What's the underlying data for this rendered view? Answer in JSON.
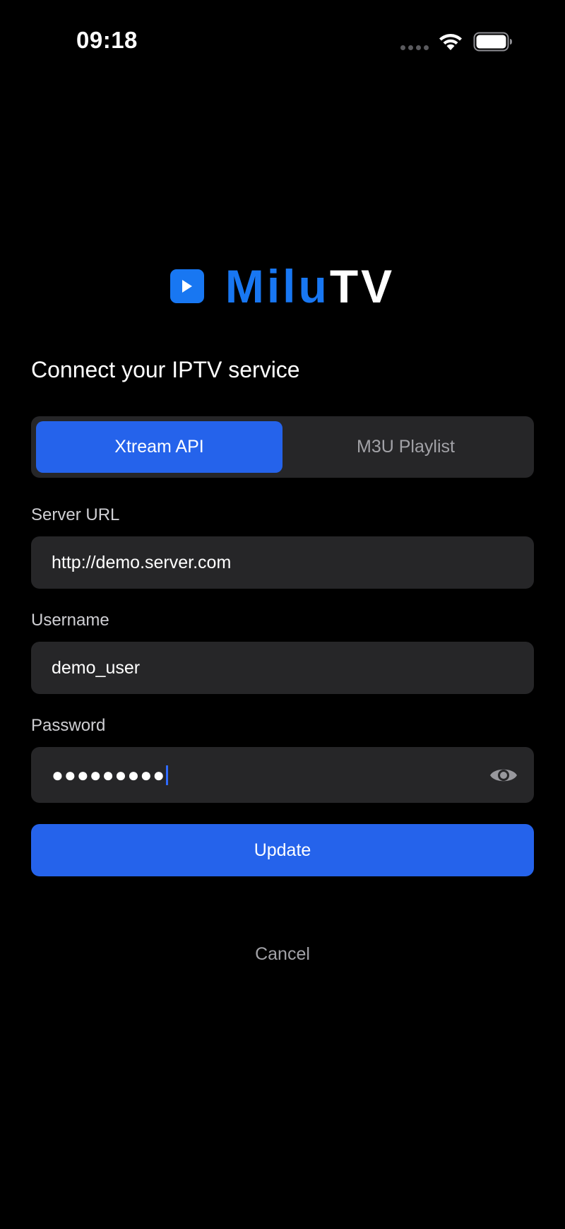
{
  "status_bar": {
    "time": "09:18",
    "icons": [
      "signal-dots-icon",
      "wifi-icon",
      "battery-icon"
    ]
  },
  "logo": {
    "text_primary": "Milu",
    "text_secondary": "TV",
    "icon": "play-icon",
    "brand_color": "#1877f2"
  },
  "title": "Connect your IPTV service",
  "tabs": [
    {
      "label": "Xtream API",
      "active": true
    },
    {
      "label": "M3U Playlist",
      "active": false
    }
  ],
  "form": {
    "server_url": {
      "label": "Server URL",
      "value": "http://demo.server.com"
    },
    "username": {
      "label": "Username",
      "value": "demo_user"
    },
    "password": {
      "label": "Password",
      "masked_value": "●●●●●●●●●",
      "icon": "eye-icon"
    }
  },
  "actions": {
    "update_label": "Update",
    "cancel_label": "Cancel"
  },
  "colors": {
    "background": "#000000",
    "surface": "#262628",
    "accent": "#2563eb",
    "muted_text": "#a2a2a7"
  }
}
